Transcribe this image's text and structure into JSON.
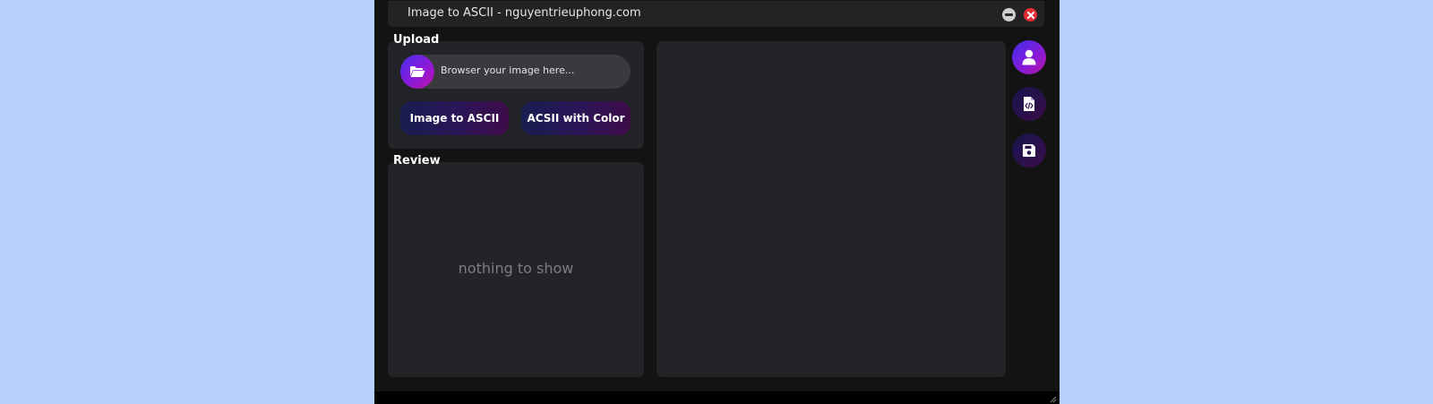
{
  "window": {
    "title": "Image to ASCII - nguyentrieuphong.com",
    "minimize_icon": "minus-circle-icon",
    "close_icon": "close-x-icon"
  },
  "upload": {
    "heading": "Upload",
    "browse_icon": "folder-open-icon",
    "file_placeholder": "Browser your image here...",
    "btn_image_to_ascii": "Image to ASCII",
    "btn_ascii_with_color": "ACSII with Color"
  },
  "review": {
    "heading": "Review",
    "empty_message": "nothing to show"
  },
  "sidebar": {
    "items": [
      {
        "icon": "user-icon"
      },
      {
        "icon": "code-file-icon"
      },
      {
        "icon": "save-icon"
      }
    ]
  },
  "colors": {
    "page_background": "#b8d2fe",
    "window_background": "#131313",
    "panel_background": "#232427",
    "accent_blue": "#3f2cee",
    "accent_magenta": "#b7169e",
    "close_red": "#e52d33"
  }
}
